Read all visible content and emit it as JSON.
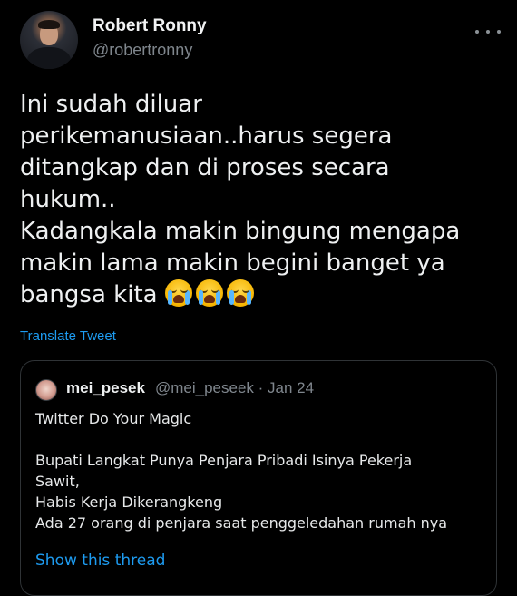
{
  "author": {
    "name": "Robert Ronny",
    "handle": "@robertronny",
    "avatar_icon": "profile-photo"
  },
  "tweet": {
    "lines": [
      "Ini sudah diluar",
      "perikemanusiaan..harus segera",
      "ditangkap dan di proses secara",
      "hukum..",
      "Kadangkala makin bingung mengapa",
      "makin lama makin begini banget ya",
      "bangsa kita"
    ],
    "emoji_icons": [
      "loudly-crying-face-emoji",
      "loudly-crying-face-emoji",
      "loudly-crying-face-emoji"
    ],
    "translate_label": "Translate Tweet"
  },
  "quoted": {
    "name": "mei_pesek",
    "meta": "@mei_peseek · Jan 24",
    "lines": [
      "Twitter Do Your Magic",
      "",
      "Bupati Langkat Punya Penjara Pribadi Isinya Pekerja",
      "Sawit,",
      " Habis Kerja Dikerangkeng",
      "Ada 27 orang di penjara saat penggeledahan rumah nya"
    ],
    "show_thread_label": "Show this thread"
  },
  "colors": {
    "background": "#000000",
    "text": "#e7e9ea",
    "secondary": "#7f868d",
    "link": "#1d9bf0",
    "border": "#2f3336"
  }
}
